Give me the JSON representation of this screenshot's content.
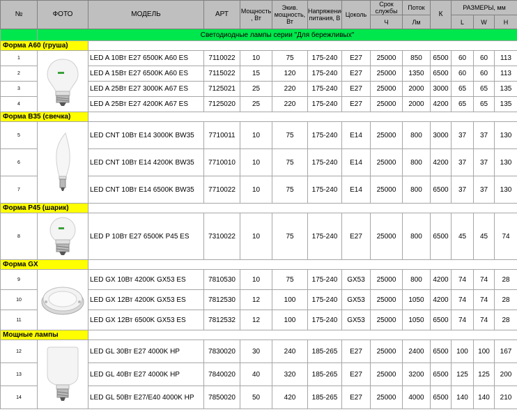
{
  "headers": {
    "num": "№",
    "photo": "ФОТО",
    "model": "МОДЕЛЬ",
    "art": "АРТ",
    "power": "Мощность , Вт",
    "equiv": "Экив. мощность, Вт",
    "voltage": "Напряжение питания, В",
    "base": "Цоколь",
    "life": "Срок службы",
    "life_unit": "Ч",
    "flux": "Поток",
    "flux_unit": "Лм",
    "k": "К",
    "sizes": "РАЗМЕРЫ, мм",
    "l": "L",
    "w": "W",
    "h": "H"
  },
  "series_title": "Светодиодные лампы серии \"Для бережливых\"",
  "sections": [
    {
      "label": "Форма А60 (груша)",
      "photo": "a60-bulb-photo",
      "rows": [
        {
          "n": "1",
          "model": "LED A 10Вт E27 6500K A60 ES",
          "art": "7110022",
          "power": "10",
          "equiv": "75",
          "voltage": "175-240",
          "base": "E27",
          "life": "25000",
          "flux": "850",
          "k": "6500",
          "l": "60",
          "w": "60",
          "h": "113"
        },
        {
          "n": "2",
          "model": "LED A 15Вт E27 6500K A60 ES",
          "art": "7115022",
          "power": "15",
          "equiv": "120",
          "voltage": "175-240",
          "base": "E27",
          "life": "25000",
          "flux": "1350",
          "k": "6500",
          "l": "60",
          "w": "60",
          "h": "113"
        },
        {
          "n": "3",
          "model": "LED A 25Вт E27 3000K A67 ES",
          "art": "7125021",
          "power": "25",
          "equiv": "220",
          "voltage": "175-240",
          "base": "E27",
          "life": "25000",
          "flux": "2000",
          "k": "3000",
          "l": "65",
          "w": "65",
          "h": "135"
        },
        {
          "n": "4",
          "model": "LED A 25Вт E27 4200K A67 ES",
          "art": "7125020",
          "power": "25",
          "equiv": "220",
          "voltage": "175-240",
          "base": "E27",
          "life": "25000",
          "flux": "2000",
          "k": "4200",
          "l": "65",
          "w": "65",
          "h": "135"
        }
      ]
    },
    {
      "label": "Форма В35 (свечка)",
      "photo": "candle-bulb-photo",
      "rows": [
        {
          "n": "5",
          "model": "LED CNT 10Вт  E14 3000K BW35",
          "art": "7710011",
          "power": "10",
          "equiv": "75",
          "voltage": "175-240",
          "base": "E14",
          "life": "25000",
          "flux": "800",
          "k": "3000",
          "l": "37",
          "w": "37",
          "h": "130"
        },
        {
          "n": "6",
          "model": "LED CNT 10Вт  E14 4200K BW35",
          "art": "7710010",
          "power": "10",
          "equiv": "75",
          "voltage": "175-240",
          "base": "E14",
          "life": "25000",
          "flux": "800",
          "k": "4200",
          "l": "37",
          "w": "37",
          "h": "130"
        },
        {
          "n": "7",
          "model": "LED CNT 10Вт  E14 6500K BW35",
          "art": "7710022",
          "power": "10",
          "equiv": "75",
          "voltage": "175-240",
          "base": "E14",
          "life": "25000",
          "flux": "800",
          "k": "6500",
          "l": "37",
          "w": "37",
          "h": "130"
        }
      ]
    },
    {
      "label": "Форма Р45 (шарик)",
      "photo": "p45-bulb-photo",
      "rows": [
        {
          "n": "8",
          "model": "LED P 10Вт  E27 6500K P45 ES",
          "art": "7310022",
          "power": "10",
          "equiv": "75",
          "voltage": "175-240",
          "base": "E27",
          "life": "25000",
          "flux": "800",
          "k": "6500",
          "l": "45",
          "w": "45",
          "h": "74"
        }
      ]
    },
    {
      "label": "Форма GX",
      "photo": "gx53-lamp-photo",
      "rows": [
        {
          "n": "9",
          "model": "LED GX 10Вт 4200K GX53 ES",
          "art": "7810530",
          "power": "10",
          "equiv": "75",
          "voltage": "175-240",
          "base": "GX53",
          "life": "25000",
          "flux": "800",
          "k": "4200",
          "l": "74",
          "w": "74",
          "h": "28"
        },
        {
          "n": "10",
          "model": "LED GX 12Вт 4200K GX53 ES",
          "art": "7812530",
          "power": "12",
          "equiv": "100",
          "voltage": "175-240",
          "base": "GX53",
          "life": "25000",
          "flux": "1050",
          "k": "4200",
          "l": "74",
          "w": "74",
          "h": "28"
        },
        {
          "n": "11",
          "model": "LED GX 12Вт 6500K GX53 ES",
          "art": "7812532",
          "power": "12",
          "equiv": "100",
          "voltage": "175-240",
          "base": "GX53",
          "life": "25000",
          "flux": "1050",
          "k": "6500",
          "l": "74",
          "w": "74",
          "h": "28"
        }
      ]
    },
    {
      "label": "Мощные лампы",
      "photo": "high-power-bulb-photo",
      "rows": [
        {
          "n": "12",
          "model": "LED GL 30Вт E27 4000K HP",
          "art": "7830020",
          "power": "30",
          "equiv": "240",
          "voltage": "185-265",
          "base": "E27",
          "life": "25000",
          "flux": "2400",
          "k": "6500",
          "l": "100",
          "w": "100",
          "h": "167"
        },
        {
          "n": "13",
          "model": "LED GL 40Вт E27 4000K HP",
          "art": "7840020",
          "power": "40",
          "equiv": "320",
          "voltage": "185-265",
          "base": "E27",
          "life": "25000",
          "flux": "3200",
          "k": "6500",
          "l": "125",
          "w": "125",
          "h": "200"
        },
        {
          "n": "14",
          "model": "LED GL 50Вт E27/E40 4000K HP",
          "art": "7850020",
          "power": "50",
          "equiv": "420",
          "voltage": "185-265",
          "base": "E27",
          "life": "25000",
          "flux": "4000",
          "k": "6500",
          "l": "140",
          "w": "140",
          "h": "210"
        }
      ]
    }
  ],
  "colors": {
    "header_bg": "#bfbfbf",
    "title_bg": "#00e64d",
    "section_bg": "#ffff00"
  }
}
